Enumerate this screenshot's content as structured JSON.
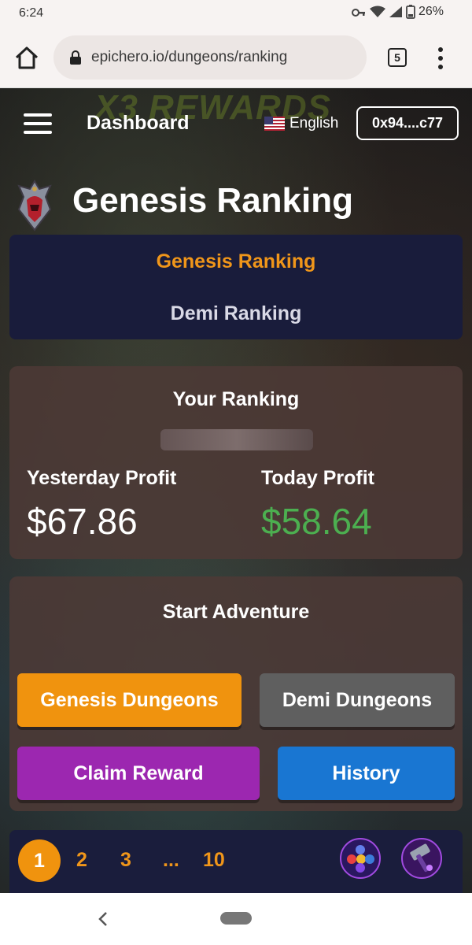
{
  "status_bar": {
    "time": "6:24",
    "battery": "26%"
  },
  "browser": {
    "url": "epichero.io/dungeons/ranking",
    "tab_count": "5"
  },
  "header": {
    "banner_text": "X3 REWARDS",
    "dashboard_label": "Dashboard",
    "language": "English",
    "wallet": "0x94....c77"
  },
  "page": {
    "title": "Genesis Ranking"
  },
  "ranking_tabs": [
    {
      "label": "Genesis Ranking",
      "active": true
    },
    {
      "label": "Demi Ranking",
      "active": false
    }
  ],
  "your_ranking": {
    "title": "Your Ranking",
    "yesterday_label": "Yesterday Profit",
    "yesterday_value": "$67.86",
    "today_label": "Today Profit",
    "today_value": "$58.64"
  },
  "adventure": {
    "title": "Start Adventure",
    "genesis_button": "Genesis Dungeons",
    "demi_button": "Demi Dungeons",
    "claim_button": "Claim Reward",
    "history_button": "History"
  },
  "pagination": {
    "pages": [
      "1",
      "2",
      "3",
      "...",
      "10"
    ],
    "current": "1"
  },
  "icons": {
    "menu": "hamburger-menu-icon",
    "flag": "us-flag-icon",
    "logo": "hero-helmet-icon",
    "chains": "multichain-icon",
    "hammer": "hammer-icon"
  },
  "colors": {
    "accent_orange": "#f0930e",
    "profit_green": "#4caf50",
    "claim_purple": "#9c27b0",
    "history_blue": "#1976d2",
    "tabs_navy": "#191c3b"
  }
}
